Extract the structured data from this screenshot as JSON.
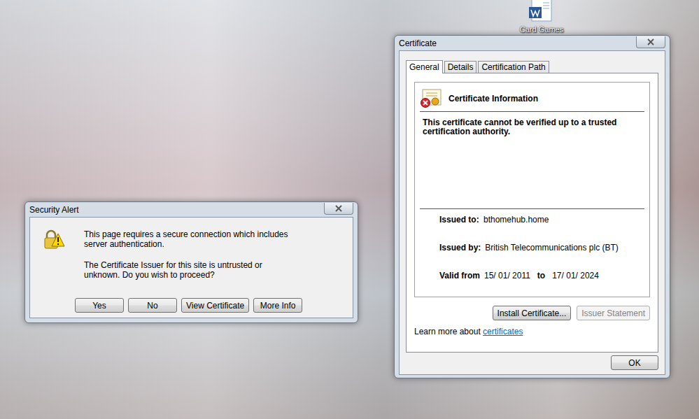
{
  "desktop": {
    "icons": [
      {
        "label": "Card Games"
      }
    ]
  },
  "security_alert": {
    "title": "Security Alert",
    "paragraphs": [
      [
        "This page requires a secure connection which includes",
        "server authentication."
      ],
      [
        "The Certificate Issuer for this site is untrusted or",
        "unknown.  Do you wish to proceed?"
      ]
    ],
    "buttons": [
      {
        "label": "Yes",
        "disabled": false
      },
      {
        "label": "No",
        "disabled": false
      },
      {
        "label": "View Certificate",
        "disabled": false
      },
      {
        "label": "More Info",
        "disabled": false
      }
    ]
  },
  "certificate": {
    "title": "Certificate",
    "tabs": [
      {
        "label": "General",
        "selected": true
      },
      {
        "label": "Details",
        "selected": false
      },
      {
        "label": "Certification Path",
        "selected": false
      }
    ],
    "heading": "Certificate Information",
    "statement": [
      "This certificate cannot be verified up to a trusted",
      "certification authority."
    ],
    "fields": [
      {
        "label": "Issued to:",
        "value": "bthomehub.home"
      },
      {
        "label": "Issued by:",
        "value": "British Telecommunications plc (BT)"
      }
    ],
    "validity": {
      "label": "Valid from",
      "from": "15/ 01/ 2011",
      "to_label": "to",
      "to": "17/ 01/ 2024"
    },
    "buttons": [
      {
        "label": "Install Certificate...",
        "disabled": false
      },
      {
        "label": "Issuer Statement",
        "disabled": true
      }
    ],
    "learn_more": {
      "text": "Learn more about",
      "link": "certificates"
    },
    "ok": "OK"
  }
}
